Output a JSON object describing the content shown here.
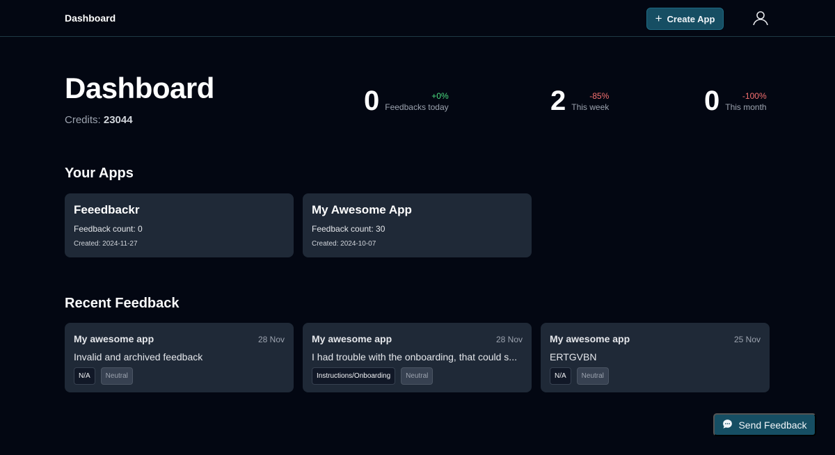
{
  "header": {
    "brand": "Dashboard",
    "create_label": "Create App"
  },
  "page": {
    "title": "Dashboard",
    "credits_label": "Credits:",
    "credits_value": "23044"
  },
  "stats": [
    {
      "value": "0",
      "delta": "+0%",
      "label": "Feedbacks today",
      "trend": "positive"
    },
    {
      "value": "2",
      "delta": "-85%",
      "label": "This week",
      "trend": "negative"
    },
    {
      "value": "0",
      "delta": "-100%",
      "label": "This month",
      "trend": "negative"
    }
  ],
  "apps_section": {
    "title": "Your Apps",
    "apps": [
      {
        "name": "Feeedbackr",
        "count": "Feedback count: 0",
        "created": "Created: 2024-11-27"
      },
      {
        "name": "My Awesome App",
        "count": "Feedback count: 30",
        "created": "Created: 2024-10-07"
      }
    ]
  },
  "feedback_section": {
    "title": "Recent Feedback",
    "items": [
      {
        "app": "My awesome app",
        "date": "28 Nov",
        "text": "Invalid and archived feedback",
        "category": "N/A",
        "sentiment": "Neutral"
      },
      {
        "app": "My awesome app",
        "date": "28 Nov",
        "text": "I had trouble with the onboarding, that could s...",
        "category": "Instructions/Onboarding",
        "sentiment": "Neutral"
      },
      {
        "app": "My awesome app",
        "date": "25 Nov",
        "text": "ERTGVBN",
        "category": "N/A",
        "sentiment": "Neutral"
      }
    ]
  },
  "send_feedback": {
    "label": "Send Feedback",
    "icon": "chat-bubble-icon"
  },
  "icons": {
    "create": "plus-icon",
    "user": "user-icon"
  },
  "colors": {
    "background": "#030712",
    "card": "#1f2937",
    "accent": "#164e63",
    "positive": "#4ade80",
    "negative": "#f87171"
  }
}
